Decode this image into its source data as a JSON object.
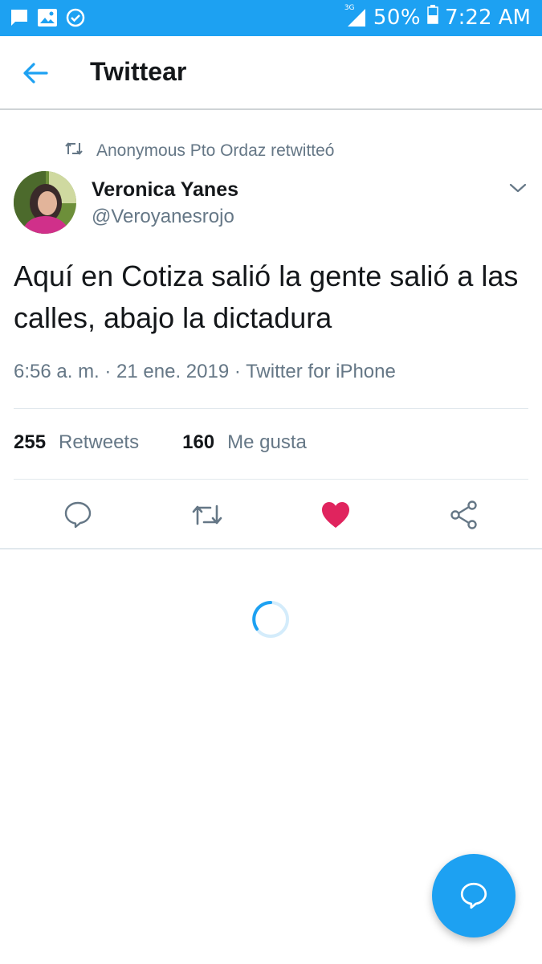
{
  "status_bar": {
    "network": "3G",
    "battery_percent": "50%",
    "time": "7:22 AM",
    "icons": [
      "chat-icon",
      "image-icon",
      "check-circle-icon"
    ]
  },
  "app_bar": {
    "title": "Twittear",
    "back_icon": "arrow-left-icon"
  },
  "tweet": {
    "retweet_context": "Anonymous Pto Ordaz retwitteó",
    "author_name": "Veronica Yanes",
    "author_handle": "@Veroyanesrojo",
    "text": "Aquí en Cotiza salió la gente salió a las calles, abajo la dictadura",
    "meta": "6:56 a. m. · 21 ene. 2019 · Twitter for iPhone",
    "retweets_count": "255",
    "retweets_label": "Retweets",
    "likes_count": "160",
    "likes_label": "Me gusta",
    "liked": true
  },
  "colors": {
    "accent": "#1da1f2",
    "like": "#e0245e",
    "secondary_text": "#657786"
  }
}
